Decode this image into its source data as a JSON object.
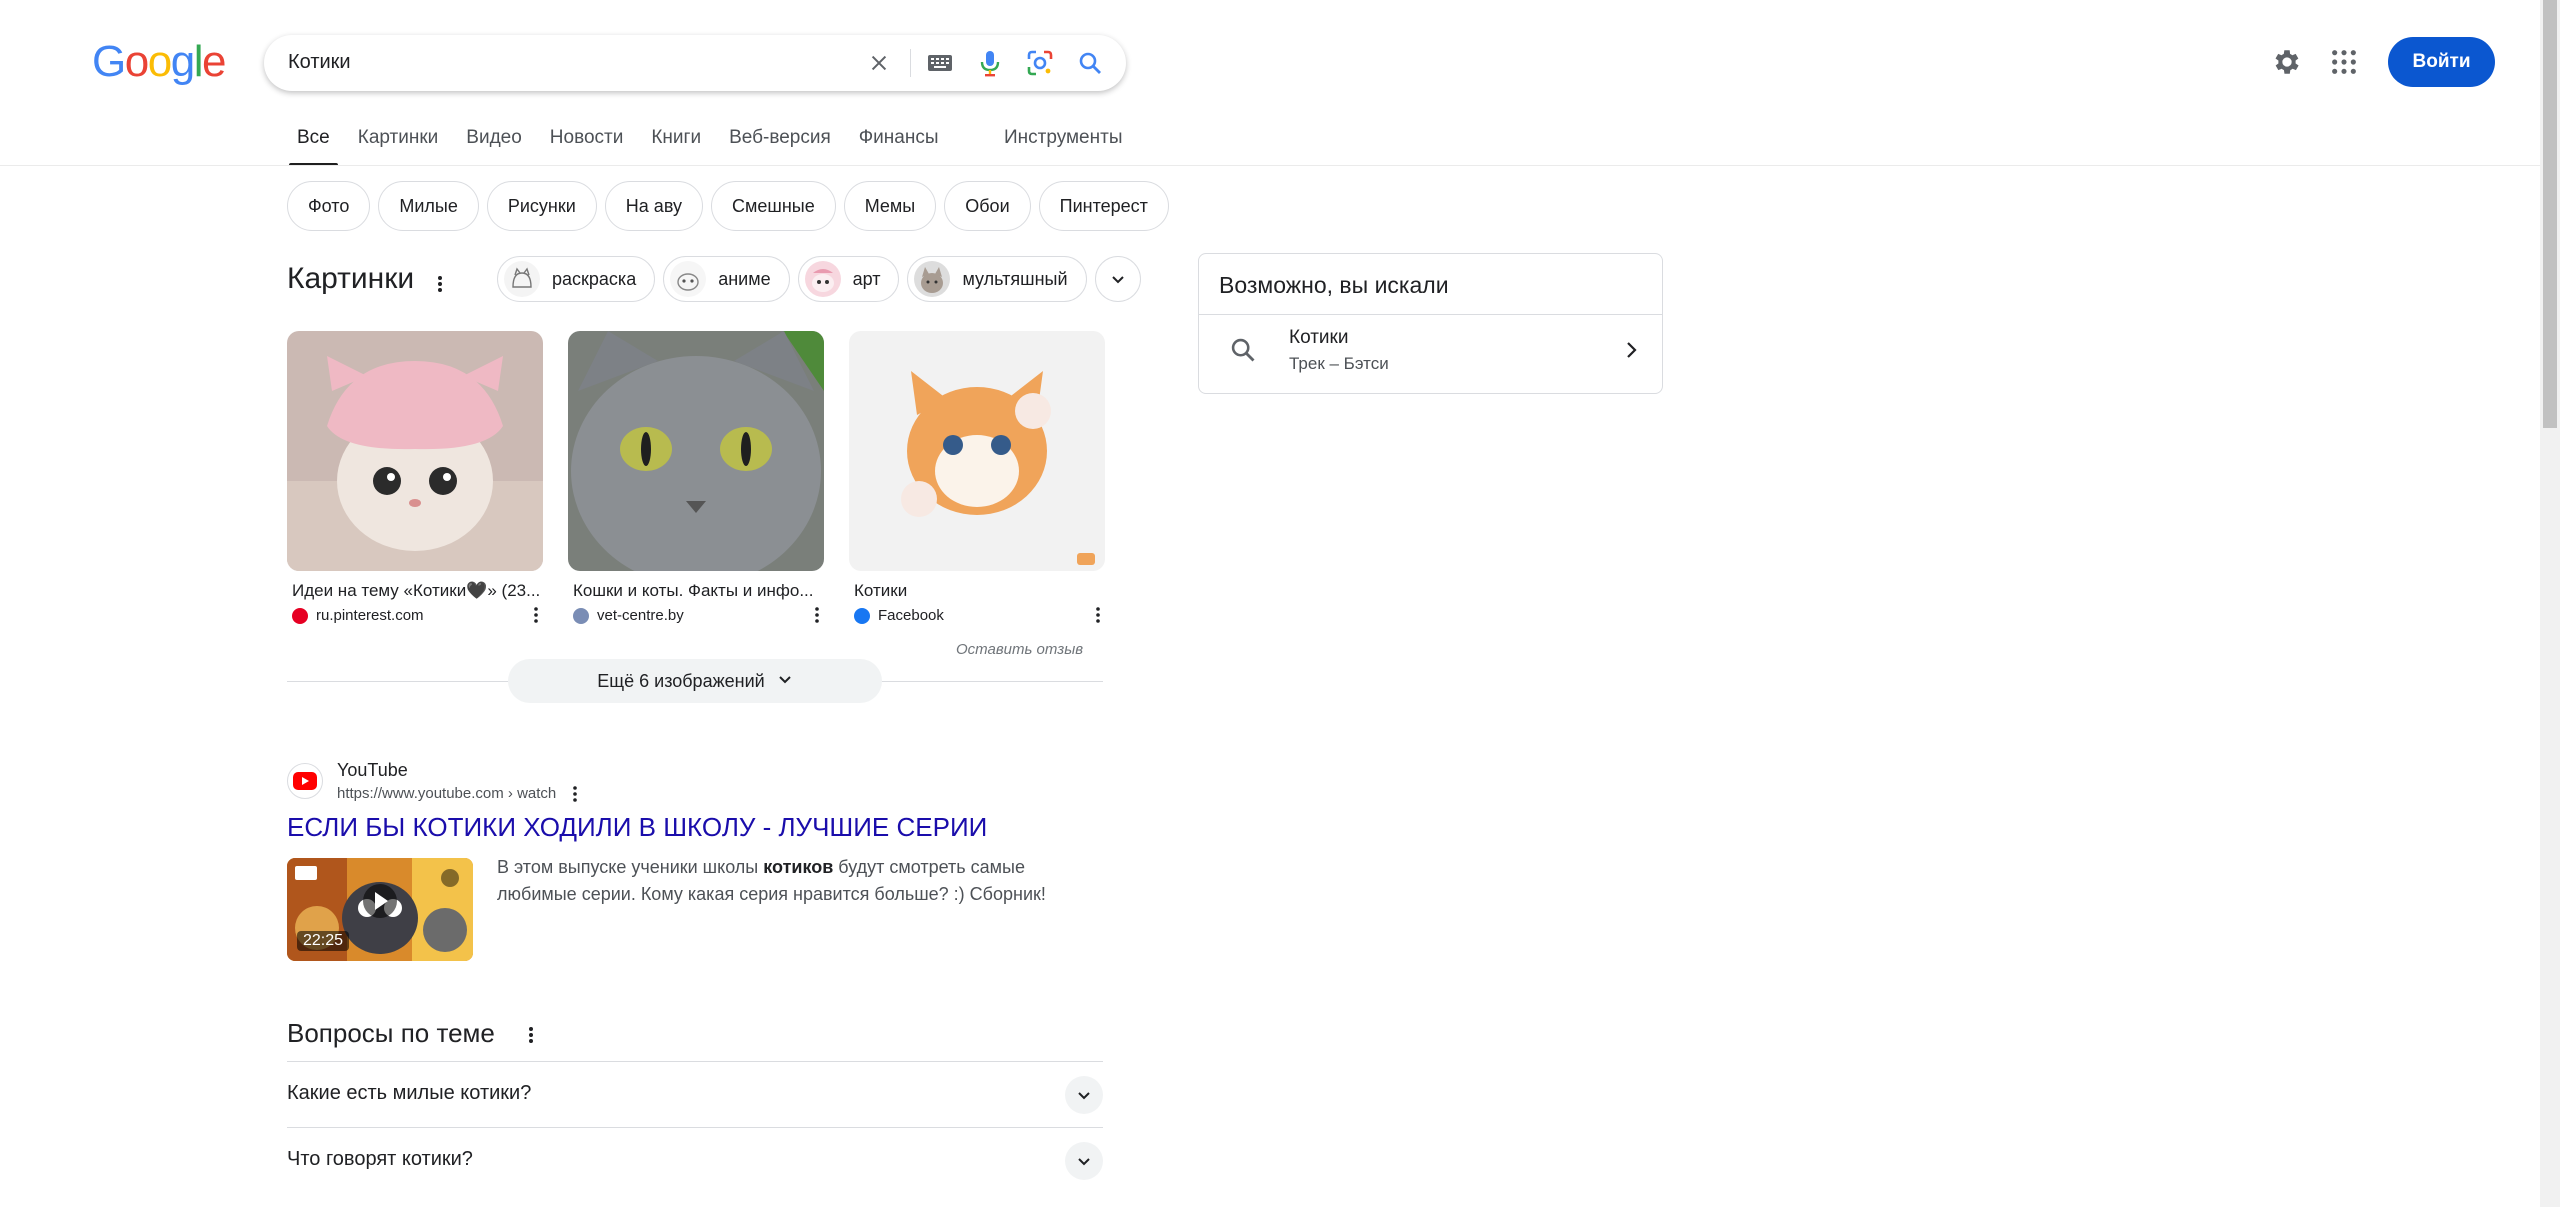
{
  "logo": {
    "letters": [
      "G",
      "o",
      "o",
      "g",
      "l",
      "e"
    ],
    "colors": [
      "#4285F4",
      "#EA4335",
      "#FBBC05",
      "#4285F4",
      "#34A853",
      "#EA4335"
    ]
  },
  "search": {
    "value": "Котики"
  },
  "header": {
    "signin_label": "Войти"
  },
  "tabs": [
    {
      "label": "Все",
      "active": true
    },
    {
      "label": "Картинки"
    },
    {
      "label": "Видео"
    },
    {
      "label": "Новости"
    },
    {
      "label": "Книги"
    },
    {
      "label": "Веб-версия"
    },
    {
      "label": "Финансы"
    }
  ],
  "tools_label": "Инструменты",
  "chips": [
    "Фото",
    "Милые",
    "Рисунки",
    "На аву",
    "Смешные",
    "Мемы",
    "Обои",
    "Пинтерест"
  ],
  "images": {
    "title": "Картинки",
    "chips": [
      "раскраска",
      "аниме",
      "арт",
      "мультяшный"
    ],
    "cards": [
      {
        "caption": "Идеи на тему «Котики🖤» (23...",
        "source": "ru.pinterest.com",
        "fav_color": "#e60023"
      },
      {
        "caption": "Кошки и коты. Факты и инфо...",
        "source": "vet-centre.by",
        "fav_color": "#7a8db5"
      },
      {
        "caption": "Котики",
        "source": "Facebook",
        "fav_color": "#1877f2"
      }
    ],
    "feedback": "Оставить отзыв",
    "more_label": "Ещё 6 изображений"
  },
  "result": {
    "site": "YouTube",
    "url": "https://www.youtube.com › watch",
    "title": "ЕСЛИ БЫ КОТИКИ ХОДИЛИ В ШКОЛУ - ЛУЧШИЕ СЕРИИ",
    "duration": "22:25",
    "snippet_before": "В этом выпуске ученики школы ",
    "snippet_bold": "котиков",
    "snippet_after": " будут смотреть самые любимые серии. Кому какая серия нравится больше? :) Сборник!"
  },
  "questions": {
    "title": "Вопросы по теме",
    "items": [
      "Какие есть милые котики?",
      "Что говорят котики?"
    ]
  },
  "side": {
    "heading": "Возможно, вы искали",
    "name": "Котики",
    "sub": "Трек – Бэтси"
  }
}
